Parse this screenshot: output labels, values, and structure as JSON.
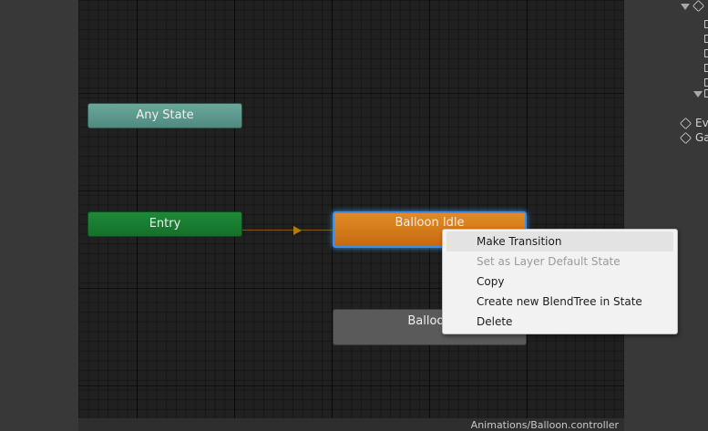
{
  "graph": {
    "states": {
      "any_state": "Any State",
      "entry": "Entry",
      "balloon_idle": "Balloon Idle",
      "balloon_other": "Balloon"
    }
  },
  "context_menu": {
    "items": [
      {
        "label": "Make Transition",
        "enabled": true,
        "highlighted": true
      },
      {
        "label": "Set as Layer Default State",
        "enabled": false
      },
      {
        "label": "Copy",
        "enabled": true
      },
      {
        "label": "Create new BlendTree in State",
        "enabled": true
      },
      {
        "label": "Delete",
        "enabled": true
      }
    ]
  },
  "hierarchy": {
    "items": [
      {
        "label": "Ev",
        "icon": "cube-icon"
      },
      {
        "label": "Ga",
        "icon": "cube-icon"
      }
    ]
  },
  "status_bar": {
    "path": "Animations/Balloon.controller"
  },
  "colors": {
    "any_state": "#5f9c8f",
    "entry": "#19802f",
    "selected_state": "#d97c1c",
    "selection_outline": "#3b8fe8",
    "inactive_state": "#5a5a5a"
  }
}
